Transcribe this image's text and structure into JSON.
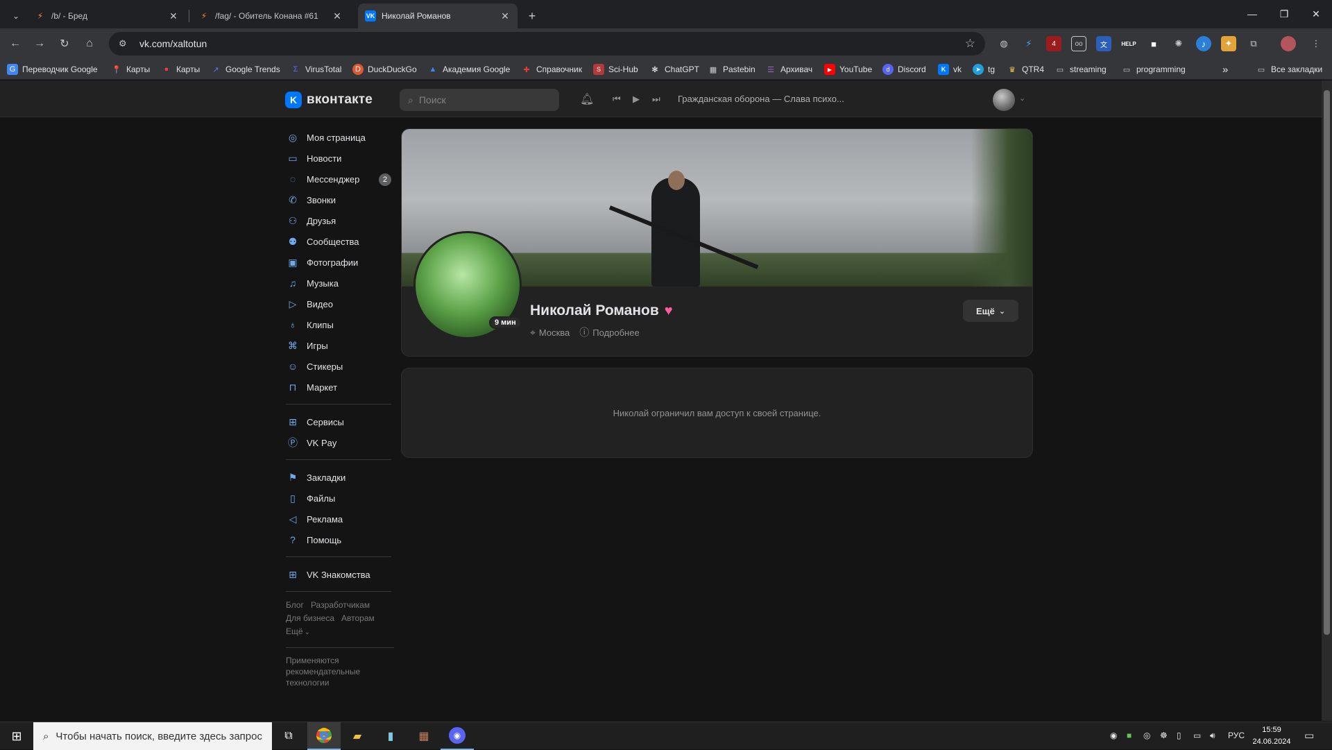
{
  "browser": {
    "tabs": [
      {
        "title": "/b/ - Бред",
        "favicon": "lightning-icon",
        "active": false
      },
      {
        "title": "/fag/ - Обитель Конана #61",
        "favicon": "lightning-icon",
        "active": false
      },
      {
        "title": "Николай Романов",
        "favicon": "vk-icon",
        "active": true
      }
    ],
    "url": "vk.com/xaltotun",
    "bookmarks": [
      "Переводчик Google",
      "Карты",
      "Карты",
      "Google Trends",
      "VirusTotal",
      "DuckDuckGo",
      "Академия Google",
      "Справочник",
      "Sci-Hub",
      "ChatGPT",
      "Pastebin",
      "Архивач",
      "YouTube",
      "Discord",
      "vk",
      "tg",
      "QTR4",
      "streaming",
      "programming"
    ],
    "all_bookmarks": "Все закладки",
    "ext_badge": "4",
    "ext_help": "HELP"
  },
  "vk": {
    "logo_text": "вконтакте",
    "search_placeholder": "Поиск",
    "now_playing": "Гражданская оборона — Слава психо...",
    "menu_main": [
      {
        "label": "Моя страница",
        "icon": "user-circle-icon"
      },
      {
        "label": "Новости",
        "icon": "news-icon"
      },
      {
        "label": "Мессенджер",
        "icon": "message-icon",
        "badge": "2"
      },
      {
        "label": "Звонки",
        "icon": "phone-icon"
      },
      {
        "label": "Друзья",
        "icon": "friends-icon"
      },
      {
        "label": "Сообщества",
        "icon": "communities-icon"
      },
      {
        "label": "Фотографии",
        "icon": "photo-icon"
      },
      {
        "label": "Музыка",
        "icon": "music-icon"
      },
      {
        "label": "Видео",
        "icon": "video-icon"
      },
      {
        "label": "Клипы",
        "icon": "clips-icon"
      },
      {
        "label": "Игры",
        "icon": "gamepad-icon"
      },
      {
        "label": "Стикеры",
        "icon": "smile-icon"
      },
      {
        "label": "Маркет",
        "icon": "bag-icon"
      }
    ],
    "menu_services": [
      {
        "label": "Сервисы",
        "icon": "services-icon"
      },
      {
        "label": "VK Pay",
        "icon": "vkpay-icon"
      }
    ],
    "menu_misc": [
      {
        "label": "Закладки",
        "icon": "bookmark-icon"
      },
      {
        "label": "Файлы",
        "icon": "file-icon"
      },
      {
        "label": "Реклама",
        "icon": "megaphone-icon"
      },
      {
        "label": "Помощь",
        "icon": "help-icon"
      }
    ],
    "menu_dating": [
      {
        "label": "VK Знакомства",
        "icon": "services-icon"
      }
    ],
    "footer_links": {
      "blog": "Блог",
      "devs": "Разработчикам",
      "business": "Для бизнеса",
      "authors": "Авторам",
      "more": "Ещё"
    },
    "footer_note": "Применяются рекомендательные технологии",
    "profile": {
      "name": "Николай Романов",
      "online": "9 мин",
      "city": "Москва",
      "details": "Подробнее",
      "more_button": "Ещё",
      "closed_text": "Николай ограничил вам доступ к своей странице."
    }
  },
  "taskbar": {
    "search_placeholder": "Чтобы начать поиск, введите здесь запрос",
    "lang": "РУС",
    "time": "15:59",
    "date": "24.06.2024"
  },
  "colors": {
    "vk_blue": "#0077ff",
    "accent_icon": "#71aaeb",
    "bg": "#141414",
    "card": "#222222",
    "heart": "#ff5c9d"
  }
}
